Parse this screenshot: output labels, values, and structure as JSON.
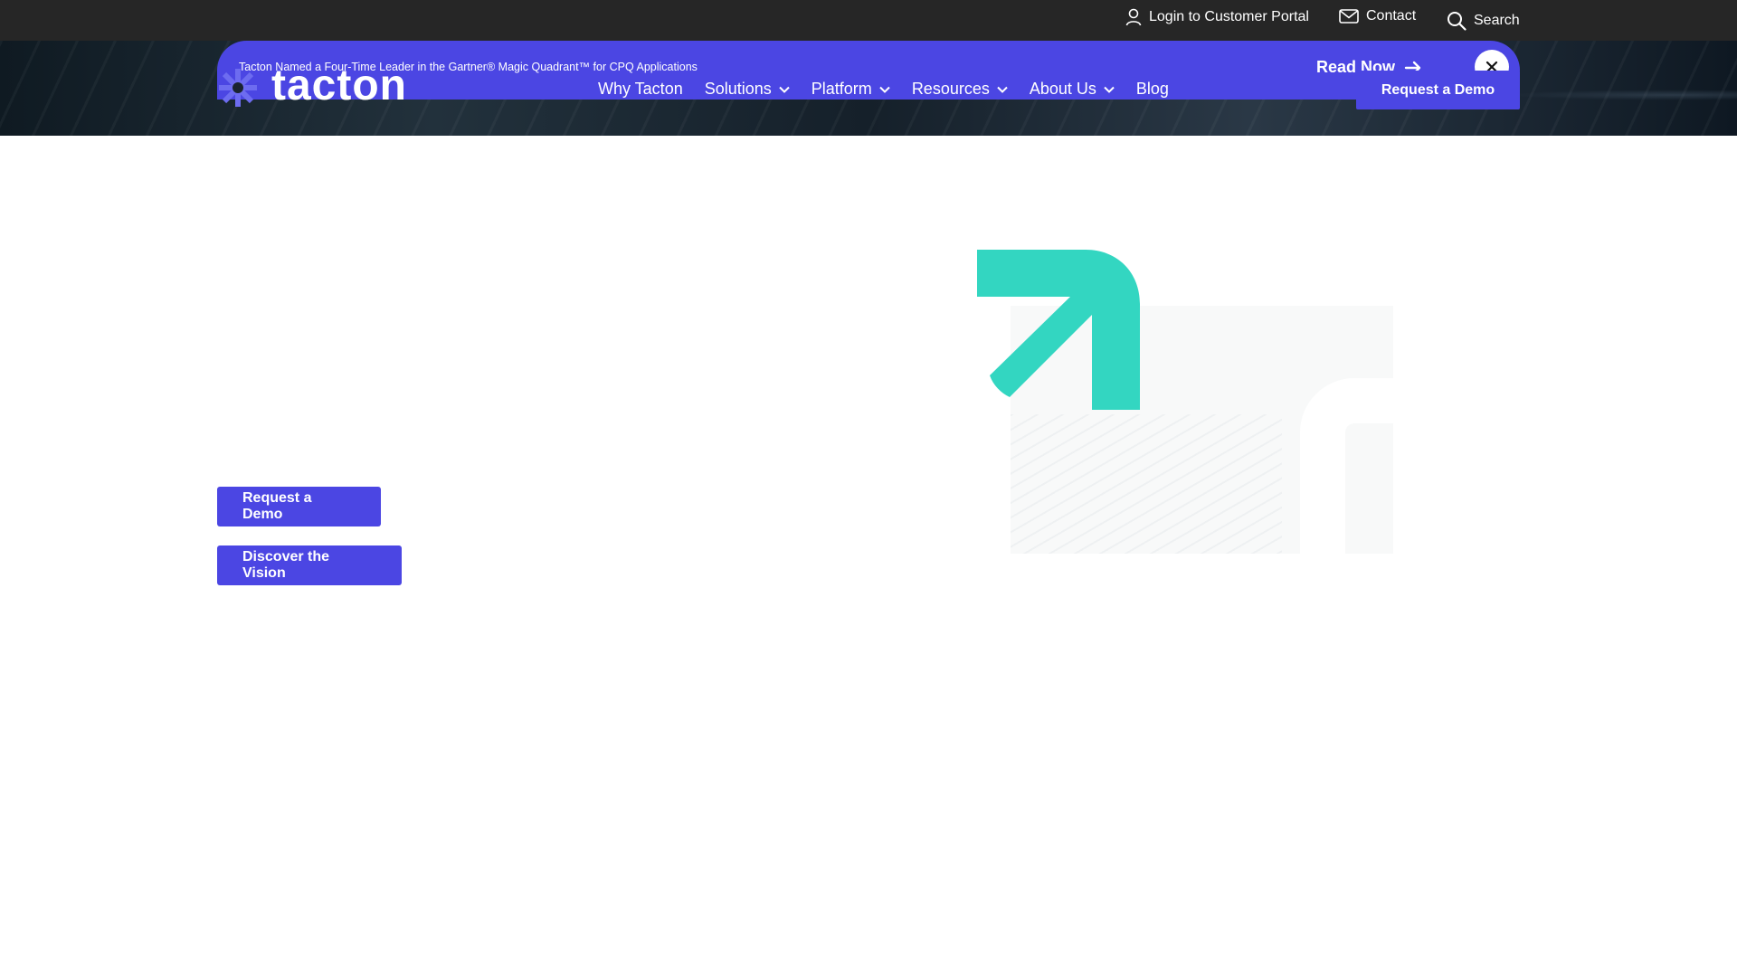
{
  "utility": {
    "login_label": "Login to Customer Portal",
    "contact_label": "Contact",
    "search_label": "Search"
  },
  "announcement": {
    "text": "Tacton Named a Four-Time Leader in the Gartner® Magic Quadrant™ for CPQ Applications",
    "read_now_label": "Read Now"
  },
  "brand": {
    "name": "tacton",
    "accent": "#4b46e3",
    "teal": "#33d6c1"
  },
  "nav": {
    "items": [
      {
        "label": "Why Tacton",
        "dropdown": false
      },
      {
        "label": "Solutions",
        "dropdown": true
      },
      {
        "label": "Platform",
        "dropdown": true
      },
      {
        "label": "Resources",
        "dropdown": true
      },
      {
        "label": "About Us",
        "dropdown": true
      },
      {
        "label": "Blog",
        "dropdown": false
      }
    ],
    "demo_label": "Request a Demo"
  },
  "hero": {
    "demo_label": "Request a Demo",
    "vision_label": "Discover the Vision"
  }
}
